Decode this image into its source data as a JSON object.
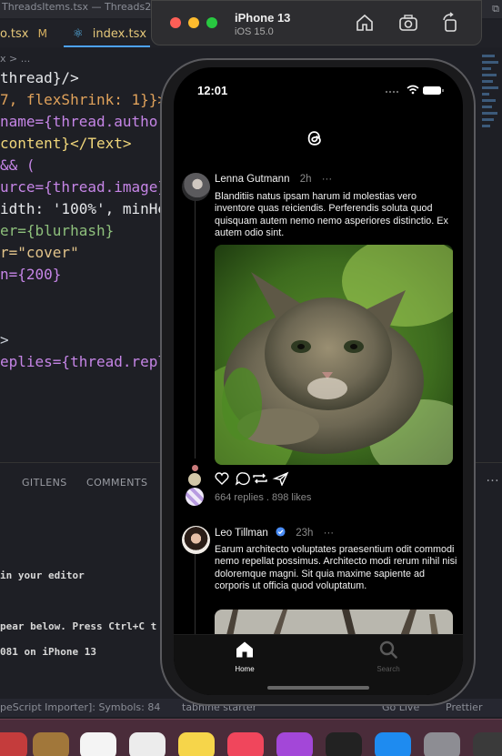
{
  "vscode": {
    "title": "ThreadsItems.tsx — Threads2",
    "tabs": [
      {
        "label": "o.tsx",
        "badge": "M"
      },
      {
        "label": "index.tsx",
        "badge": "M"
      }
    ],
    "breadcrumb": "x > ...",
    "code_lines": [
      {
        "text": " thread}/>"
      },
      {
        "text": " 7, flexShrink: 1}}>"
      },
      {
        "text": "name={thread.author"
      },
      {
        "text": " content}</Text>"
      },
      {
        "text": " && ("
      },
      {
        "text": "urce={thread.image}"
      },
      {
        "text": "idth: '100%', minHe"
      },
      {
        "text": "er={blurhash}"
      },
      {
        "text": "r=\"cover\""
      },
      {
        "text": "n={200}"
      },
      {
        "text": ">"
      },
      {
        "text": "eplies={thread.repl"
      }
    ],
    "panel_tabs": [
      "GITLENS",
      "COMMENTS"
    ],
    "terminal_lines": [
      "in your editor",
      "pear below. Press Ctrl+C t",
      "081 on iPhone 13"
    ],
    "status_items": [
      "peScript Importer]: Symbols: 84",
      "tabnine starter",
      "Go Live",
      "Prettier"
    ]
  },
  "simulator": {
    "device_name": "iPhone 13",
    "os_version": "iOS 15.0",
    "toolbar_icons": [
      "home-icon",
      "screenshot-icon",
      "rotate-icon"
    ]
  },
  "app": {
    "clock": "12:01",
    "brand_icon": "threads-logo-icon",
    "posts": [
      {
        "author": "Lenna Gutmann",
        "time": "2h",
        "more": "···",
        "body": "Blanditiis natus ipsam harum id molestias vero inventore quas reiciendis. Perferendis soluta quod quisquam autem nemo nemo asperiores distinctio. Ex autem odio sint.",
        "image_description": "kitten",
        "stats": "664 replies . 898 likes"
      },
      {
        "author": "Leo Tillman",
        "time": "23h",
        "more": "···",
        "verified": true,
        "body": "Earum architecto voluptates praesentium odit commodi nemo repellat possimus. Architecto modi rerum nihil nisi doloremque magni. Sit quia maxime sapiente ad corporis ut officia quod voluptatum."
      }
    ],
    "tabbar": {
      "items": [
        {
          "label": "Home",
          "icon": "home-icon",
          "active": true
        },
        {
          "label": "Search",
          "icon": "search-icon",
          "active": false
        }
      ]
    },
    "colors": {
      "background": "#000000",
      "text": "#f2f2f2",
      "muted": "#8a8a8a",
      "verified": "#4a8df6"
    }
  }
}
